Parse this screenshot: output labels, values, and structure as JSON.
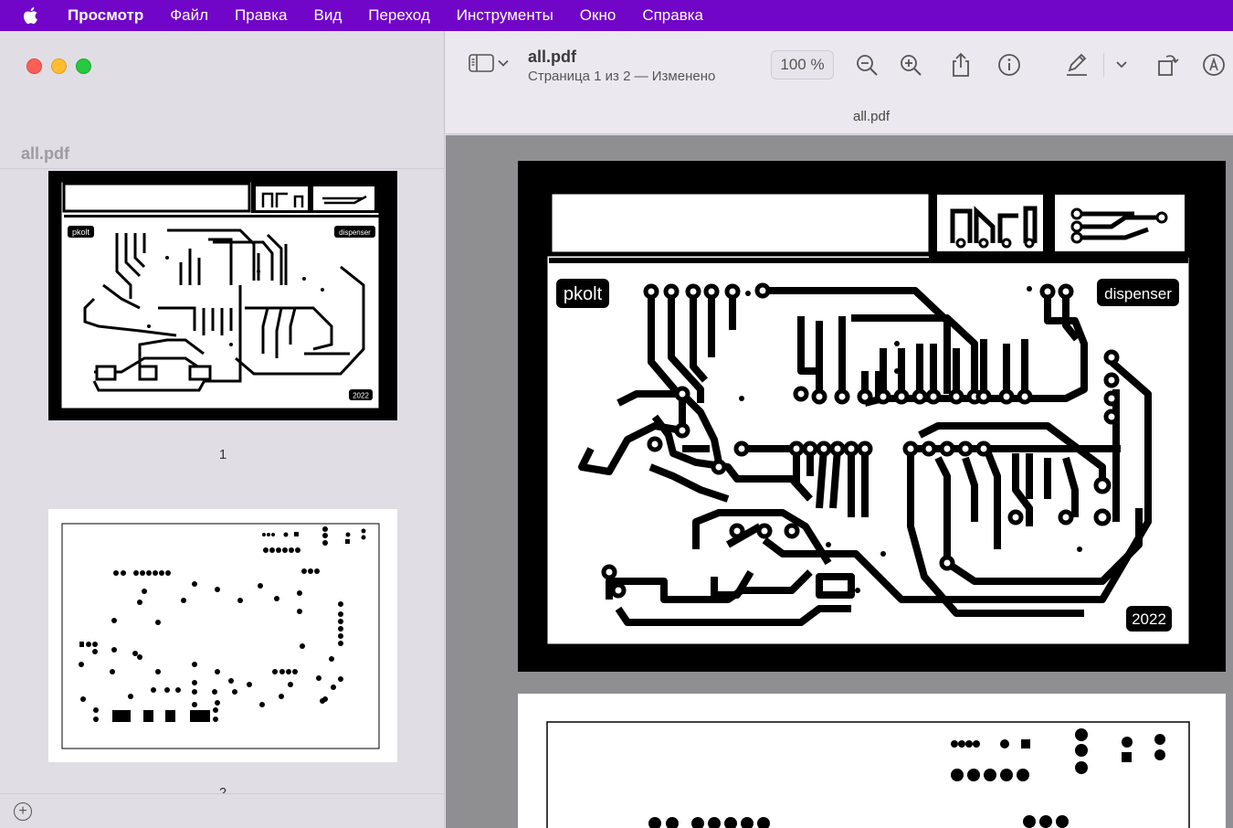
{
  "menubar": {
    "items": [
      "Просмотр",
      "Файл",
      "Правка",
      "Вид",
      "Переход",
      "Инструменты",
      "Окно",
      "Справка"
    ]
  },
  "sidebar": {
    "title": "all.pdf",
    "thumbnails": [
      {
        "label": "1"
      },
      {
        "label": "2"
      }
    ]
  },
  "toolbar": {
    "doc_title": "all.pdf",
    "doc_subtitle": "Страница 1 из 2 — Изменено",
    "zoom": "100 %",
    "tab_title": "all.pdf"
  },
  "pcb": {
    "top_left_label": "pkolt",
    "top_right_label": "dispenser",
    "year_label": "2022"
  },
  "colors": {
    "menubar_bg": "#7206c8",
    "close": "#ff5f57",
    "minimize": "#febc2e",
    "maximize": "#28c840"
  },
  "icons": [
    "apple-icon",
    "sidebar-toggle-icon",
    "chevron-down-icon",
    "zoom-out-icon",
    "zoom-in-icon",
    "share-icon",
    "info-icon",
    "markup-pen-icon",
    "rotate-icon",
    "annotate-icon",
    "add-icon"
  ]
}
